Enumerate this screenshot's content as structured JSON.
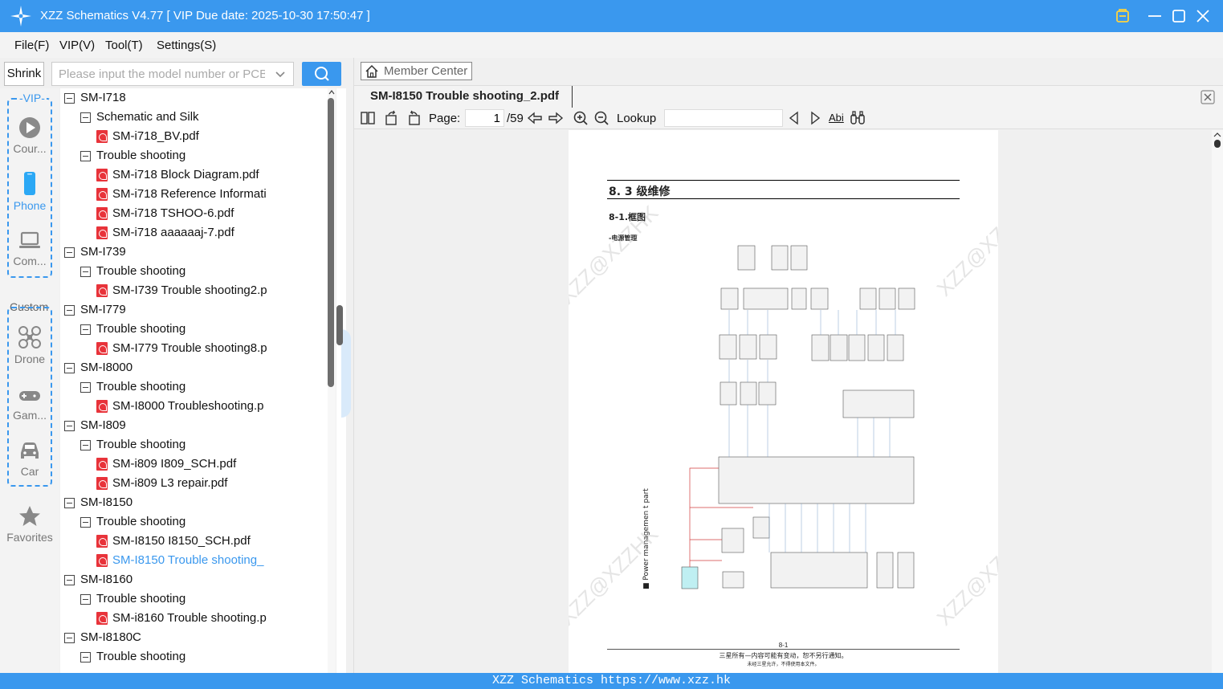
{
  "app": {
    "title": "XZZ Schematics V4.77 [ VIP Due date: 2025-10-30 17:50:47 ]",
    "status_text": "XZZ Schematics https://www.xzz.hk",
    "accent_color": "#3a98ee"
  },
  "menu": [
    "File(F)",
    "VIP(V)",
    "Tool(T)",
    "Settings(S)"
  ],
  "search": {
    "shrink_label": "Shrink",
    "placeholder": "Please input the model number or PCB"
  },
  "categories": {
    "vip_label": "-VIP-",
    "custom_label": "Custom",
    "items": [
      {
        "label": "Cour...",
        "icon": "play-icon"
      },
      {
        "label": "Phone",
        "icon": "phone-icon"
      },
      {
        "label": "Com...",
        "icon": "laptop-icon"
      },
      {
        "label": "Drone",
        "icon": "drone-icon"
      },
      {
        "label": "Gam...",
        "icon": "gamepad-icon"
      },
      {
        "label": "Car",
        "icon": "car-icon"
      },
      {
        "label": "Favorites",
        "icon": "star-icon"
      }
    ]
  },
  "tree": [
    {
      "type": "folder",
      "level": 0,
      "label": "SM-I718"
    },
    {
      "type": "folder",
      "level": 1,
      "label": "Schematic and Silk"
    },
    {
      "type": "file",
      "level": 2,
      "label": "SM-i718_BV.pdf"
    },
    {
      "type": "folder",
      "level": 1,
      "label": "Trouble shooting"
    },
    {
      "type": "file",
      "level": 2,
      "label": "SM-i718 Block Diagram.pdf"
    },
    {
      "type": "file",
      "level": 2,
      "label": "SM-i718 Reference Informati"
    },
    {
      "type": "file",
      "level": 2,
      "label": "SM-i718 TSHOO-6.pdf"
    },
    {
      "type": "file",
      "level": 2,
      "label": "SM-i718 aaaaaaj-7.pdf"
    },
    {
      "type": "folder",
      "level": 0,
      "label": "SM-I739"
    },
    {
      "type": "folder",
      "level": 1,
      "label": "Trouble shooting"
    },
    {
      "type": "file",
      "level": 2,
      "label": "SM-I739 Trouble shooting2.p"
    },
    {
      "type": "folder",
      "level": 0,
      "label": "SM-I779"
    },
    {
      "type": "folder",
      "level": 1,
      "label": "Trouble shooting"
    },
    {
      "type": "file",
      "level": 2,
      "label": "SM-I779 Trouble shooting8.p"
    },
    {
      "type": "folder",
      "level": 0,
      "label": "SM-I8000"
    },
    {
      "type": "folder",
      "level": 1,
      "label": "Trouble shooting"
    },
    {
      "type": "file",
      "level": 2,
      "label": "SM-I8000 Troubleshooting.p"
    },
    {
      "type": "folder",
      "level": 0,
      "label": "SM-I809"
    },
    {
      "type": "folder",
      "level": 1,
      "label": "Trouble shooting"
    },
    {
      "type": "file",
      "level": 2,
      "label": "SM-i809 I809_SCH.pdf"
    },
    {
      "type": "file",
      "level": 2,
      "label": "SM-i809 L3 repair.pdf"
    },
    {
      "type": "folder",
      "level": 0,
      "label": "SM-I8150"
    },
    {
      "type": "folder",
      "level": 1,
      "label": "Trouble shooting"
    },
    {
      "type": "file",
      "level": 2,
      "label": "SM-I8150 I8150_SCH.pdf"
    },
    {
      "type": "file",
      "level": 2,
      "label": "SM-I8150 Trouble shooting_",
      "selected": true
    },
    {
      "type": "folder",
      "level": 0,
      "label": "SM-I8160"
    },
    {
      "type": "folder",
      "level": 1,
      "label": "Trouble shooting"
    },
    {
      "type": "file",
      "level": 2,
      "label": "SM-i8160 Trouble shooting.p"
    },
    {
      "type": "folder",
      "level": 0,
      "label": "SM-I8180C"
    },
    {
      "type": "folder",
      "level": 1,
      "label": "Trouble shooting"
    }
  ],
  "viewer": {
    "member_center": "Member Center",
    "tab_title": "SM-I8150 Trouble shooting_2.pdf",
    "page_label": "Page:",
    "page_current": "1",
    "page_total": "/59",
    "lookup_label": "Lookup",
    "abi_label": "Abi"
  },
  "document": {
    "heading": "8. 3 级维修",
    "subheading": "8-1.框图",
    "section": "-电源管理",
    "side_label": "■ Power managemen t part",
    "page_number": "8-1",
    "footer_line1": "三星所有—内容可能有变动，恕不另行通知。",
    "footer_line2": "未经三星允许，不得使用本文件。",
    "watermark": "XZZ@XZZHK"
  }
}
